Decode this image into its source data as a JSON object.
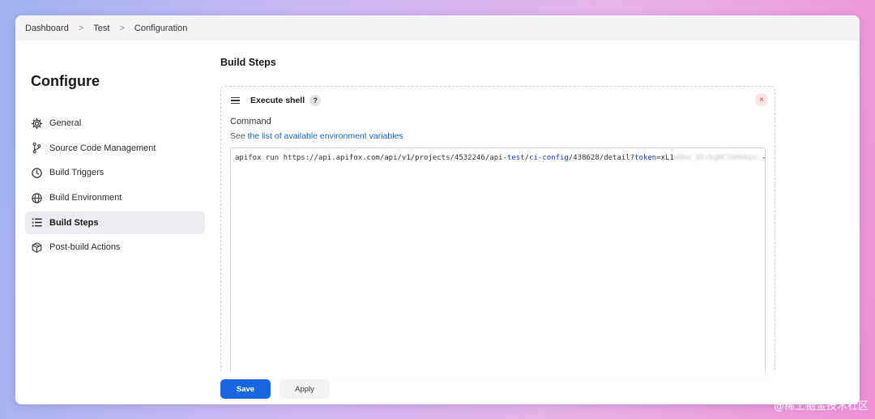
{
  "breadcrumb": {
    "items": [
      "Dashboard",
      "Test",
      "Configuration"
    ],
    "separator": ">"
  },
  "sidebar": {
    "title": "Configure",
    "items": [
      {
        "label": "General",
        "icon": "gear-icon"
      },
      {
        "label": "Source Code Management",
        "icon": "branch-icon"
      },
      {
        "label": "Build Triggers",
        "icon": "clock-icon"
      },
      {
        "label": "Build Environment",
        "icon": "globe-icon"
      },
      {
        "label": "Build Steps",
        "icon": "list-icon",
        "active": true
      },
      {
        "label": "Post-build Actions",
        "icon": "package-icon"
      }
    ]
  },
  "main": {
    "title": "Build Steps",
    "step": {
      "title": "Execute shell",
      "help": "?",
      "close": "×",
      "command_label": "Command",
      "see_prefix": "See",
      "see_link": "the list of available environment variables",
      "command": {
        "p1": "apifox run https://api.apifox.com/api/v1/projects/4532246/api-",
        "k1": "test",
        "p2": "/",
        "k2": "ci-config",
        "p3": "/438628/detail?",
        "k3": "token",
        "p4": "=xL1",
        "redacted": "m8ke_QtzbgWC5bHmbpo",
        "p5": " -r h"
      }
    }
  },
  "footer": {
    "save_label": "Save",
    "apply_label": "Apply"
  },
  "watermark": "@稀土掘金技术社区",
  "colors": {
    "accent": "#1a66e0",
    "link": "#1b62c4",
    "close": "#c93a3a"
  }
}
